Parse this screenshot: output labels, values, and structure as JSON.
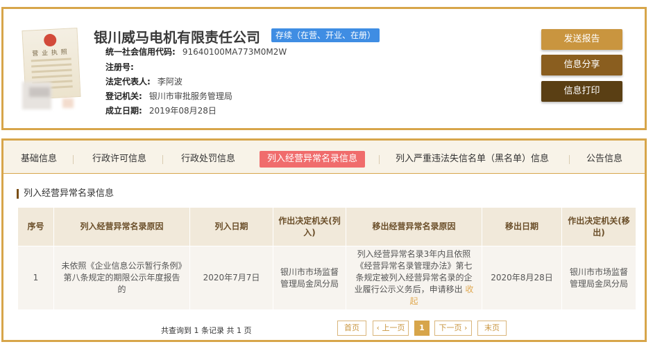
{
  "company": {
    "name": "银川威马电机有限责任公司",
    "status": "存续（在营、开业、在册）",
    "license_image_title": "营 业 执 照"
  },
  "info": [
    {
      "label": "统一社会信用代码:",
      "value": "91640100MA773M0M2W"
    },
    {
      "label": "注册号:",
      "value": ""
    },
    {
      "label": "法定代表人:",
      "value": "李阿波"
    },
    {
      "label": "登记机关:",
      "value": "银川市审批服务管理局"
    },
    {
      "label": "成立日期:",
      "value": "2019年08月28日"
    }
  ],
  "actions": {
    "send_report": "发送报告",
    "share_info": "信息分享",
    "print_info": "信息打印"
  },
  "tabs": [
    "基础信息",
    "行政许可信息",
    "行政处罚信息",
    "列入经营异常名录信息",
    "列入严重违法失信名单（黑名单）信息",
    "公告信息"
  ],
  "active_tab": "列入经营异常名录信息",
  "section_title": "列入经营异常名录信息",
  "table": {
    "headers": [
      "序号",
      "列入经营异常名录原因",
      "列入日期",
      "作出决定机关(列入)",
      "移出经营异常名录原因",
      "移出日期",
      "作出决定机关(移出)"
    ],
    "rows": [
      {
        "index": "1",
        "reason": "未依照《企业信息公示暂行条例》第八条规定的期限公示年度报告的",
        "date_in": "2020年7月7日",
        "authority_in": "银川市市场监督管理局金凤分局",
        "remove_reason": "列入经营异常名录3年内且依照《经营异常名录管理办法》第七条规定被列入经营异常名录的企业履行公示义务后，申请移出",
        "collapse_link": "收起",
        "date_out": "2020年8月28日",
        "authority_out": "银川市市场监督管理局金凤分局"
      }
    ]
  },
  "pagination": {
    "summary": "共查询到 1 条记录 共 1 页",
    "first": "首页",
    "prev": "‹ 上一页",
    "current": "1",
    "next": "下一页 ›",
    "last": "末页"
  },
  "colors": {
    "border_gold": "#d7a54a",
    "status_blue": "#3f8de3",
    "active_tab_red": "#f06c6c",
    "btn_send": "#c9953f",
    "btn_share": "#8a5e1f",
    "btn_print": "#5a3f14"
  }
}
